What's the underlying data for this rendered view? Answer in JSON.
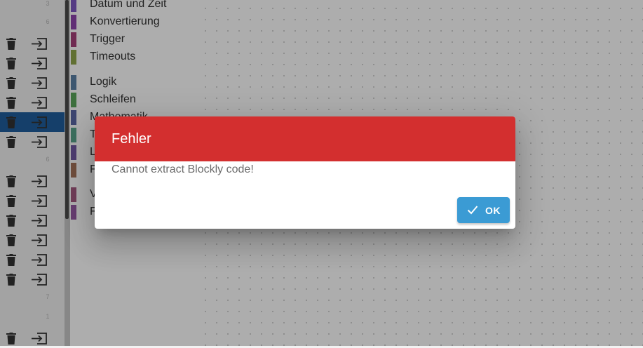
{
  "sidebar": {
    "group_numbers": [
      "3",
      "6",
      "6",
      "7",
      "1"
    ],
    "active_row_index": 6
  },
  "toolbox": {
    "categories": [
      {
        "label": "Datum und Zeit",
        "color": "#7e57c2"
      },
      {
        "label": "Konvertierung",
        "color": "#8e44ad"
      },
      {
        "label": "Trigger",
        "color": "#a5407a"
      },
      {
        "label": "Timeouts",
        "color": "#8fa64a"
      },
      {
        "label": "Logik",
        "color": "#5b80a5"
      },
      {
        "label": "Schleifen",
        "color": "#5ba55b"
      },
      {
        "label": "Mathematik",
        "color": "#5b67a5"
      },
      {
        "label": "T",
        "color": "#5ba58c"
      },
      {
        "label": "L",
        "color": "#745ba5"
      },
      {
        "label": "F",
        "color": "#a5745b"
      },
      {
        "label": "V",
        "color": "#a55b80"
      },
      {
        "label": "F",
        "color": "#995ba5"
      }
    ]
  },
  "dialog": {
    "title": "Fehler",
    "message": "Cannot extract Blockly code!",
    "ok_label": "OK",
    "header_color": "#d32f2f",
    "button_color": "#3b9bd4"
  }
}
